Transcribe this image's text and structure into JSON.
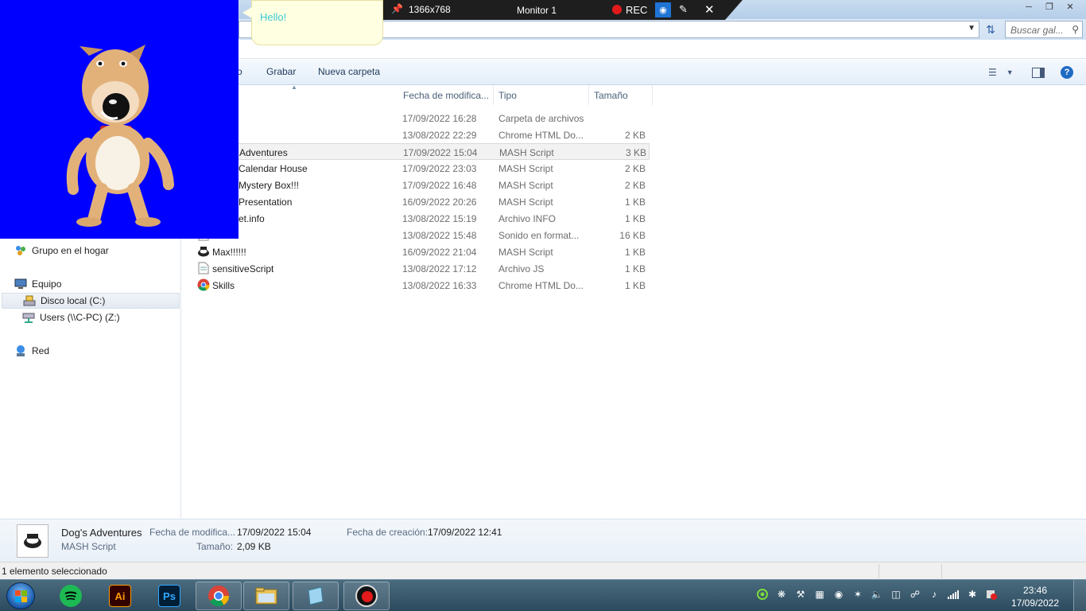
{
  "search": {
    "placeholder": "Buscar gal..."
  },
  "toolbar": {
    "grabar": "Grabar",
    "nueva_carpeta": "Nueva carpeta",
    "partial": "o"
  },
  "columns": {
    "fecha": "Fecha de modifica...",
    "tipo": "Tipo",
    "tamano": "Tamaño"
  },
  "nav": {
    "grupo": "Grupo en el hogar",
    "equipo": "Equipo",
    "disco": "Disco local (C:)",
    "users": "Users (\\\\C-PC) (Z:)",
    "red": "Red"
  },
  "files": [
    {
      "name": "",
      "date": "17/09/2022 16:28",
      "type": "Carpeta de archivos",
      "size": "",
      "icon": "folder-icon"
    },
    {
      "name": "",
      "date": "13/08/2022 22:29",
      "type": "Chrome HTML Do...",
      "size": "2 KB",
      "icon": "chrome-icon"
    },
    {
      "name": "Adventures",
      "date": "17/09/2022 15:04",
      "type": "MASH Script",
      "size": "3 KB",
      "icon": "mash-icon"
    },
    {
      "name": "Calendar House",
      "date": "17/09/2022 23:03",
      "type": "MASH Script",
      "size": "2 KB",
      "icon": "mash-icon"
    },
    {
      "name": "Mystery Box!!!",
      "date": "17/09/2022 16:48",
      "type": "MASH Script",
      "size": "2 KB",
      "icon": "mash-icon"
    },
    {
      "name": "Presentation",
      "date": "16/09/2022 20:26",
      "type": "MASH Script",
      "size": "1 KB",
      "icon": "mash-icon"
    },
    {
      "name": "et.info",
      "date": "13/08/2022 15:19",
      "type": "Archivo INFO",
      "size": "1 KB",
      "icon": "file-icon"
    },
    {
      "name": "",
      "date": "13/08/2022 15:48",
      "type": "Sonido en format...",
      "size": "16 KB",
      "icon": "sound-icon"
    },
    {
      "name": "Max!!!!!!",
      "date": "16/09/2022 21:04",
      "type": "MASH Script",
      "size": "1 KB",
      "icon": "mash-icon"
    },
    {
      "name": "sensitiveScript",
      "date": "13/08/2022 17:12",
      "type": "Archivo JS",
      "size": "1 KB",
      "icon": "js-file-icon"
    },
    {
      "name": "Skills",
      "date": "13/08/2022 16:33",
      "type": "Chrome HTML Do...",
      "size": "1 KB",
      "icon": "chrome-icon"
    }
  ],
  "details": {
    "name": "Dog's Adventures",
    "type": "MASH Script",
    "mod_label": "Fecha de modifica...",
    "mod_value": "17/09/2022 15:04",
    "size_label": "Tamaño:",
    "size_value": "2,09 KB",
    "created_label": "Fecha de creación:",
    "created_value": "17/09/2022 12:41"
  },
  "status": {
    "text": "1 elemento seleccionado"
  },
  "recorder": {
    "resolution": "1366x768",
    "monitor": "Monitor 1",
    "rec": "REC"
  },
  "agent": {
    "speech": "Hello!"
  },
  "clock": {
    "time": "23:46",
    "date": "17/09/2022"
  },
  "colors": {
    "agent_bg": "#0000ff",
    "bubble_bg": "#ffffe1",
    "speech_text": "#3cc9d6",
    "rec_dot": "#e21a1a"
  }
}
